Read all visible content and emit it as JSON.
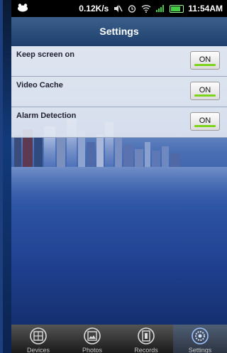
{
  "statusbar": {
    "speed": "0.12K/s",
    "time": "11:54AM"
  },
  "header": {
    "title": "Settings"
  },
  "settings": [
    {
      "label": "Keep screen on",
      "value": "ON"
    },
    {
      "label": "Video Cache",
      "value": "ON"
    },
    {
      "label": "Alarm Detection",
      "value": "ON"
    }
  ],
  "tabs": [
    {
      "label": "Devices",
      "icon": "devices-icon"
    },
    {
      "label": "Photos",
      "icon": "photos-icon"
    },
    {
      "label": "Records",
      "icon": "records-icon"
    },
    {
      "label": "Settings",
      "icon": "settings-icon",
      "active": true
    }
  ],
  "colors": {
    "toggle_on": "#7cd31a",
    "title_bg": "#2a4c7c",
    "background_blue": "#2f56a6"
  }
}
